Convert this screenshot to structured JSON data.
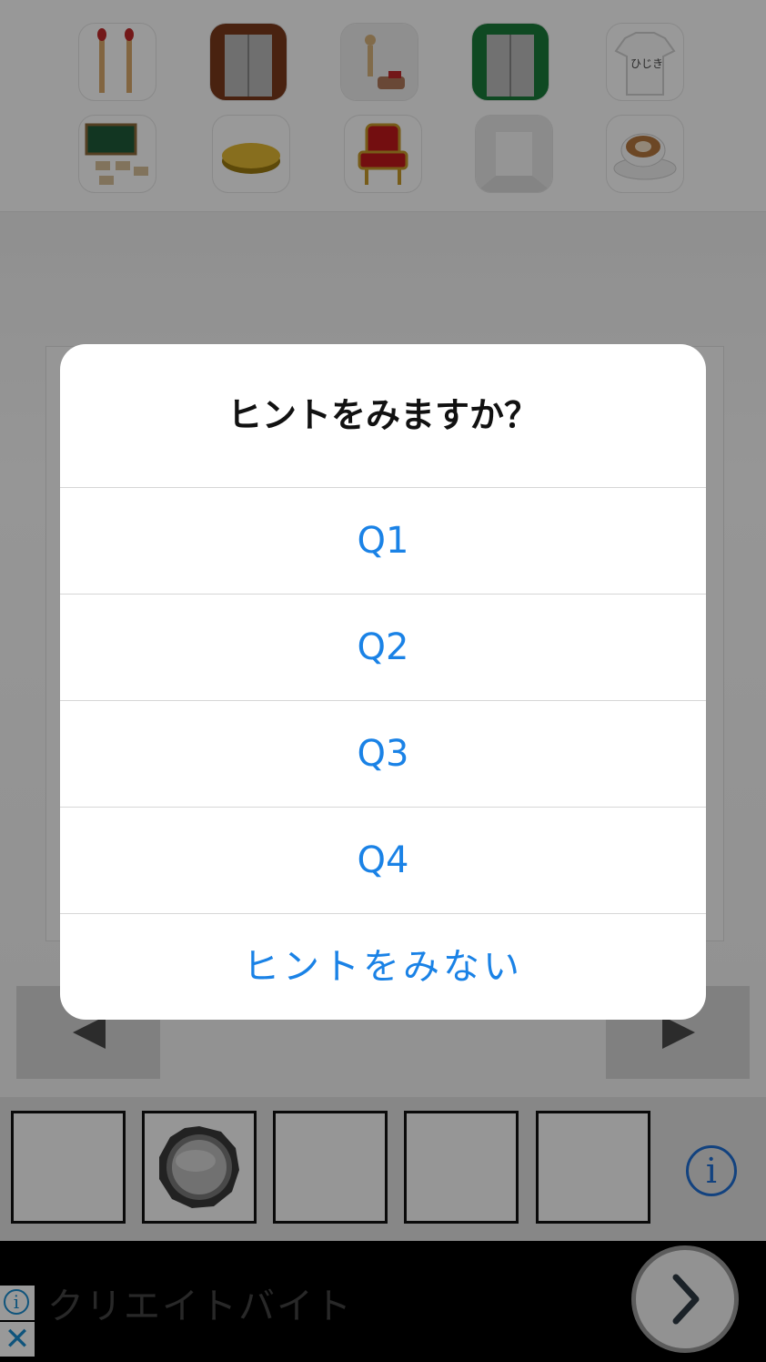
{
  "dialog": {
    "title": "ヒントをみますか？",
    "options": [
      "Q1",
      "Q2",
      "Q3",
      "Q4"
    ],
    "cancel_label": "ヒントをみない"
  },
  "icons": {
    "row1": [
      "matches-icon",
      "wooden-elevator-icon",
      "wooden-figure-icon",
      "green-elevator-icon",
      "tshirt-icon"
    ],
    "row2": [
      "classroom-blackboard-icon",
      "gold-coin-icon",
      "red-throne-chair-icon",
      "white-room-icon",
      "latte-cup-icon"
    ],
    "tshirt_text": "ひじき"
  },
  "navigation": {
    "left": "left-arrow-icon",
    "right": "right-arrow-icon"
  },
  "inventory": {
    "slot_count": 5,
    "slot_2_item": "metal-disc-icon",
    "info_icon_glyph": "i"
  },
  "ad": {
    "text": "クリエイトバイト",
    "info_glyph": "i",
    "close_glyph": "✕"
  },
  "colors": {
    "accent": "#1a82e6",
    "info_blue": "#1f6ed4",
    "overlay": "rgba(0,0,0,0.40)"
  }
}
